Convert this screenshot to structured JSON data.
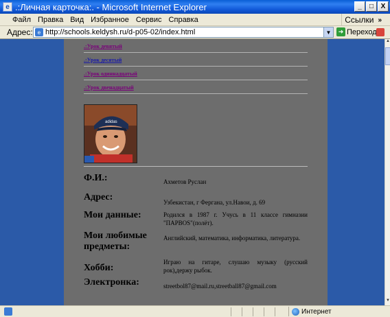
{
  "window": {
    "title": ".:Личная карточка:. - Microsoft Internet Explorer",
    "minimize": "_",
    "maximize": "□",
    "close": "X"
  },
  "menu": {
    "items": [
      "Файл",
      "Правка",
      "Вид",
      "Избранное",
      "Сервис",
      "Справка"
    ],
    "links_label": "Ссылки"
  },
  "address": {
    "label": "Адрес:",
    "url": "http://schools.keldysh.ru/d-p05-02/index.html",
    "go_label": "Переход"
  },
  "lessons": [
    ".:Урок девятый",
    ".:Урок десятый",
    ".:Урок одиннадцатый",
    ".:Урок двенадцатый"
  ],
  "profile": [
    {
      "label": "Ф.И.:",
      "value": "Ахметов Руслан"
    },
    {
      "label": "Адрес:",
      "value": "Узбекистан, г Фергана, ул.Навои, д. 69"
    },
    {
      "label": "Мои данные:",
      "value": "Родился в 1987 г. Учусь в 11 классе гимназии \"ПАРВОS\"(полёт)."
    },
    {
      "label": "Мои любимые предметы:",
      "value": "Английский, математика, информатика, литература."
    },
    {
      "label": "Хобби:",
      "value": "Играю на гитаре, слушаю музыку (русский рок),держу рыбок."
    },
    {
      "label": "Электронка:",
      "value": "streetbol87@mail.ru,streetball87@gmail.com"
    }
  ],
  "status": {
    "zone": "Интернет"
  },
  "colors": {
    "page_background": "#2b5aa8",
    "column": "#6d6d6d",
    "visited_link": "#7a007a",
    "link": "#1a1aa8"
  }
}
